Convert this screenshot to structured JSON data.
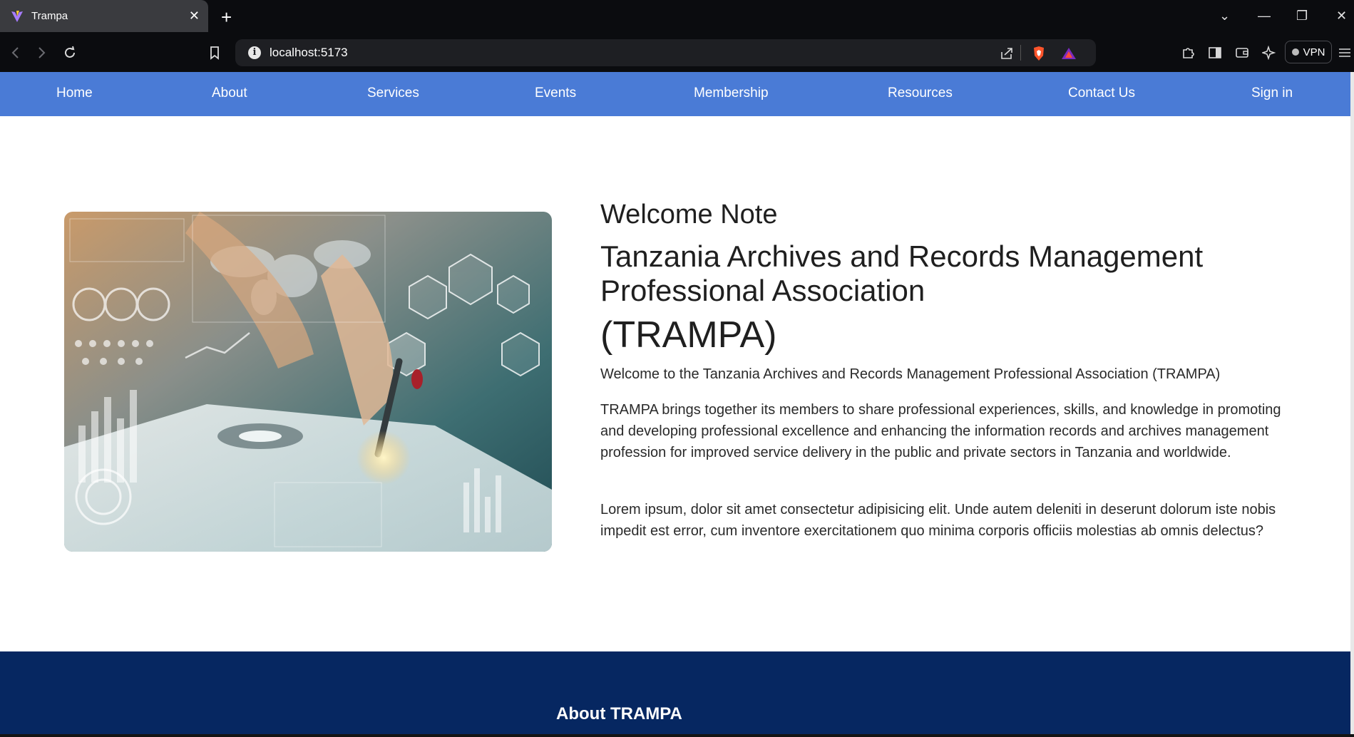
{
  "browser": {
    "tab_title": "Trampa",
    "url": "localhost:5173",
    "vpn_label": "VPN"
  },
  "nav": {
    "items": [
      "Home",
      "About",
      "Services",
      "Events",
      "Membership",
      "Resources",
      "Contact Us",
      "Sign in"
    ]
  },
  "welcome": {
    "heading": "Welcome Note",
    "org_name": "Tanzania Archives and Records Management Professional Association",
    "org_abbr": "(TRAMPA)",
    "intro": "Welcome to the Tanzania Archives and Records Management Professional Association (TRAMPA)",
    "body": "TRAMPA brings together its members to share professional experiences, skills, and knowledge in promoting and developing professional excellence and enhancing the information records and archives management profession for improved service delivery in the public and private sectors in Tanzania and worldwide.",
    "lorem": "Lorem ipsum, dolor sit amet consectetur adipisicing elit. Unde autem deleniti in deserunt dolorum iste nobis impedit est error, cum inventore exercitationem quo minima corporis officiis molestias ab omnis delectus?"
  },
  "about_section": {
    "title": "About TRAMPA"
  },
  "colors": {
    "nav_bg": "#4a7bd6",
    "footer_bg": "#062761",
    "browser_chrome": "#0b0c0f"
  }
}
